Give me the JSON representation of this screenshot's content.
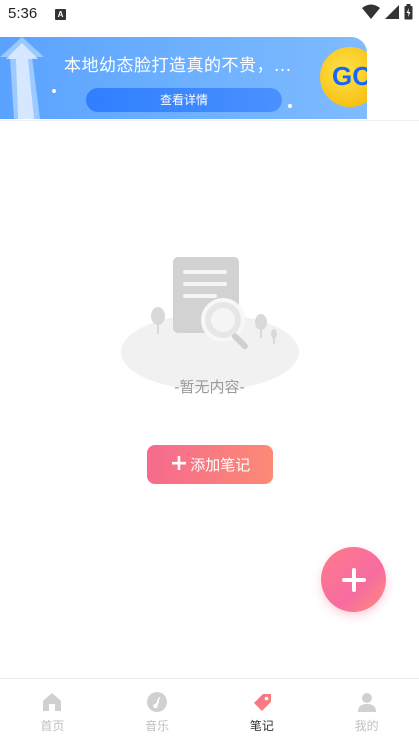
{
  "status_bar": {
    "time": "5:36",
    "notification_icon": "A"
  },
  "ad": {
    "title": "本地幼态脸打造真的不贵，...",
    "detail_button": "查看详情",
    "badge_text": "GO"
  },
  "empty_state": {
    "text": "-暂无内容-",
    "add_note_label": "添加笔记"
  },
  "bottom_nav": {
    "items": [
      {
        "label": "首页",
        "icon": "home-icon",
        "active": false
      },
      {
        "label": "音乐",
        "icon": "music-icon",
        "active": false
      },
      {
        "label": "笔记",
        "icon": "note-icon",
        "active": true
      },
      {
        "label": "我的",
        "icon": "profile-icon",
        "active": false
      }
    ]
  },
  "colors": {
    "accent_gradient_start": "#f66a8e",
    "accent_gradient_end": "#fb8a74",
    "ad_blue": "#5aa2ff",
    "inactive_gray": "#c0c0c0"
  }
}
